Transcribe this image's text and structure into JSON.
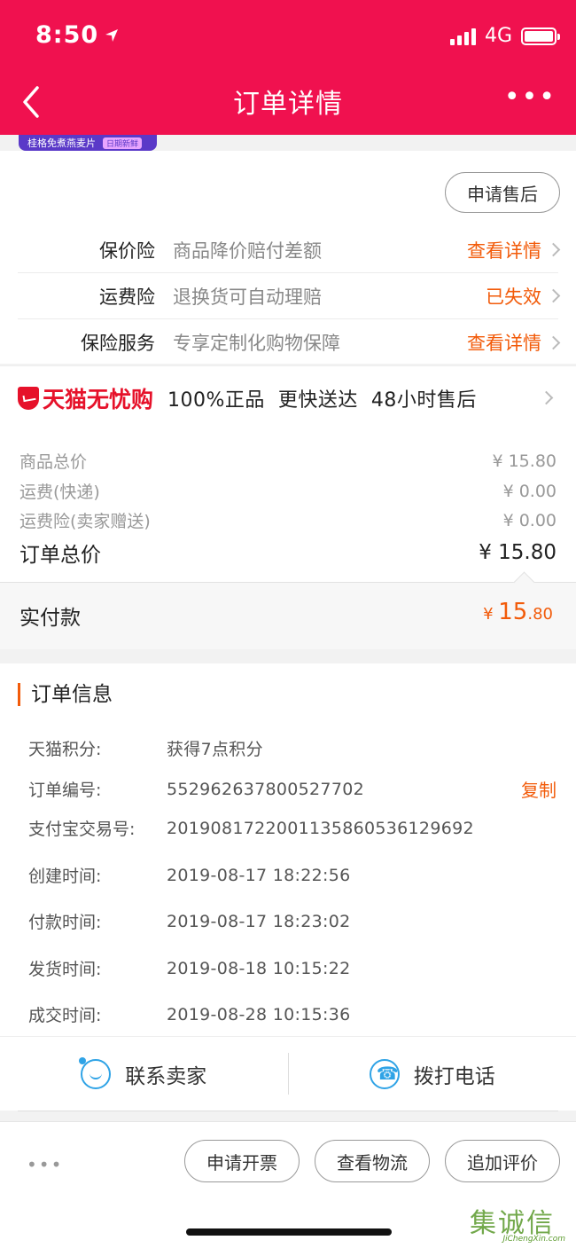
{
  "status_bar": {
    "time": "8:50",
    "network": "4G"
  },
  "nav": {
    "title": "订单详情",
    "more": "•••"
  },
  "sticker": {
    "text": "桂格免煮燕麦片",
    "badge": "日期新鲜"
  },
  "aftersale_button": "申请售后",
  "insurance": [
    {
      "label": "保价险",
      "desc": "商品降价赔付差额",
      "action": "查看详情"
    },
    {
      "label": "运费险",
      "desc": "退换货可自动理赔",
      "action": "已失效"
    },
    {
      "label": "保险服务",
      "desc": "专享定制化购物保障",
      "action": "查看详情"
    }
  ],
  "tmall": {
    "brand": "天猫无忧购",
    "features": "100%正品  更快送达  48小时售后"
  },
  "prices": {
    "goods_label": "商品总价",
    "goods_value": "¥ 15.80",
    "shipping_label": "运费(快递)",
    "shipping_value": "¥ 0.00",
    "shipping_ins_label": "运费险(卖家赠送)",
    "shipping_ins_value": "¥ 0.00",
    "total_label": "订单总价",
    "total_value": "¥ 15.80"
  },
  "paid": {
    "label": "实付款",
    "currency": "¥",
    "integer": "15",
    "decimal": ".80"
  },
  "order_info": {
    "title": "订单信息",
    "rows": [
      {
        "label": "天猫积分:",
        "value": "获得7点积分"
      },
      {
        "label": "订单编号:",
        "value": "552962637800527702",
        "action": "复制"
      },
      {
        "label": "支付宝交易号:",
        "value": "2019081722001135860536129692"
      },
      {
        "label": "创建时间:",
        "value": "2019-08-17 18:22:56"
      },
      {
        "label": "付款时间:",
        "value": "2019-08-17 18:23:02"
      },
      {
        "label": "发货时间:",
        "value": "2019-08-18 10:15:22"
      },
      {
        "label": "成交时间:",
        "value": "2019-08-28 10:15:36"
      }
    ]
  },
  "contact": {
    "seller": "联系卖家",
    "phone": "拨打电话"
  },
  "bottom_actions": {
    "more": "•••",
    "invoice": "申请开票",
    "logistics": "查看物流",
    "review": "追加评价"
  },
  "watermark": {
    "text": "集诚信",
    "url": "JiChengXin.com"
  },
  "colors": {
    "header": "#f0114f",
    "accent": "#f25b0a",
    "link_blue": "#2fa3e6"
  }
}
